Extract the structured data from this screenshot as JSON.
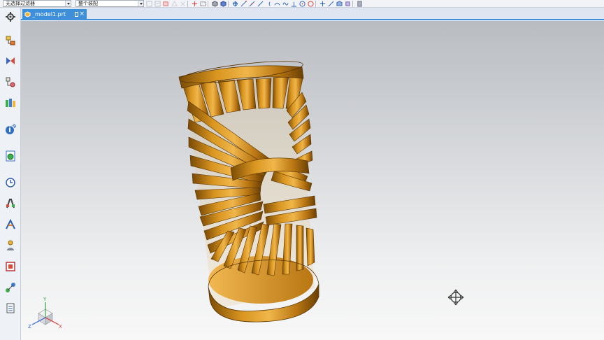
{
  "toolbar": {
    "selection_filter": "无选择过滤器",
    "scope": "整个装配"
  },
  "tab": {
    "title": "_model1.prt",
    "close": "×"
  },
  "triad": {
    "x_label": "X",
    "y_label": "Y",
    "z_label": "Z"
  },
  "colors": {
    "accent": "#3c8fd8",
    "model": "#c98a1c",
    "model_dark": "#7a4a05",
    "model_light": "#f0b64a"
  }
}
